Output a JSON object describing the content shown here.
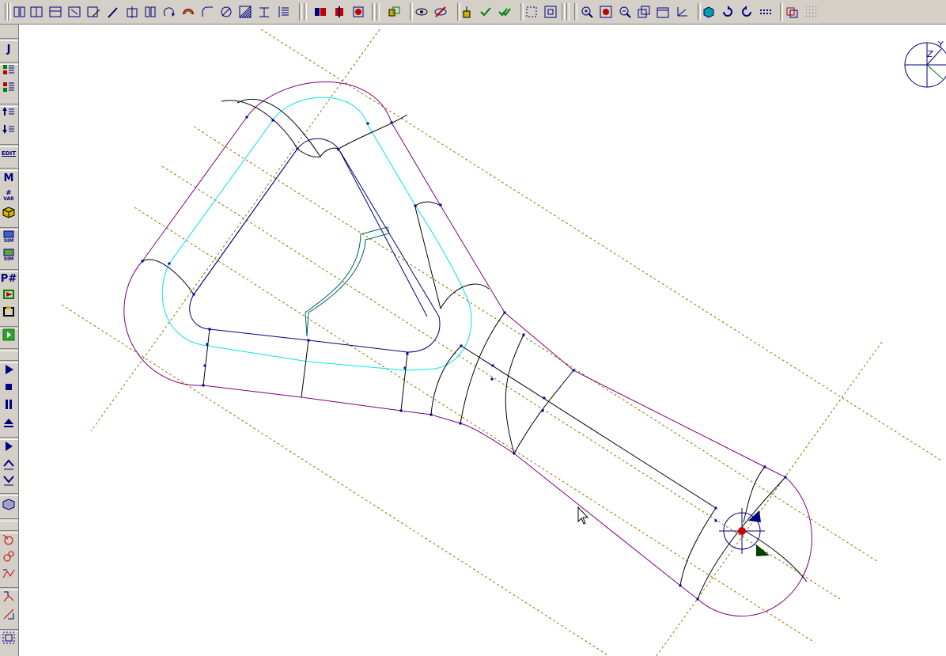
{
  "app": {
    "type": "CAM/CAD drawing view",
    "background_color": "#ffffff",
    "toolbar_color": "#d4d0c8"
  },
  "top_toolbar": {
    "groups": [
      {
        "name": "edit-tools",
        "icons": [
          "align-left-icon",
          "align-center-icon",
          "align-top-icon",
          "distribute-icon",
          "edit-icon",
          "trim-icon",
          "split-icon",
          "mirror-icon",
          "rotate-icon",
          "offset-icon",
          "fillet-icon",
          "circle-slash-icon",
          "hatch-icon",
          "dimension-icon",
          "line-spacing-icon"
        ]
      },
      {
        "name": "view-mode",
        "icons": [
          "blue-red-view-icon",
          "red-block-icon",
          "red-circle-icon"
        ]
      },
      {
        "name": "selection",
        "icons": [
          "select-chain-icon",
          "eye-icon",
          "eye-off-icon",
          "pick-icon",
          "check-icon",
          "double-check-icon",
          "frame-icon",
          "frame-all-icon"
        ]
      },
      {
        "name": "zoom",
        "icons": [
          "zoom-in-icon",
          "zoom-fit-icon",
          "zoom-out-icon",
          "view-copy-icon",
          "window-icon",
          "axis-icon",
          "solid-cube-icon",
          "refresh-icon",
          "rotate-view-icon",
          "grid-dots-icon"
        ]
      },
      {
        "name": "layers",
        "icons": [
          "layers-icon",
          "grid-icon"
        ]
      }
    ]
  },
  "left_toolbar": {
    "items": [
      {
        "name": "j-icon",
        "glyph": "J"
      },
      {
        "name": "list-green-icon"
      },
      {
        "name": "list-red-icon"
      },
      {
        "name": "move-up-icon"
      },
      {
        "name": "move-down-icon"
      },
      {
        "name": "edit-icon",
        "glyph": "EDIT"
      },
      {
        "name": "m-icon",
        "glyph": "M"
      },
      {
        "name": "var-icon",
        "glyph": "#",
        "sub": "VAR"
      },
      {
        "name": "cube-yellow-icon"
      },
      {
        "name": "sim-icon",
        "sub": "SIM"
      },
      {
        "name": "sim2-icon",
        "sub": "SIM"
      },
      {
        "name": "p-number-icon",
        "glyph": "P#"
      },
      {
        "name": "post-icon"
      },
      {
        "name": "post-alt-icon"
      },
      {
        "name": "exit-green-icon"
      },
      {
        "name": "play-icon"
      },
      {
        "name": "stop-icon"
      },
      {
        "name": "pause-icon"
      },
      {
        "name": "eject-icon"
      },
      {
        "name": "step-play-icon"
      },
      {
        "name": "step-up-icon"
      },
      {
        "name": "step-down-icon"
      },
      {
        "name": "stock-cube-icon"
      },
      {
        "name": "tool-red-1-icon"
      },
      {
        "name": "tool-red-2-icon"
      },
      {
        "name": "tool-red-3-icon"
      },
      {
        "name": "tool-path-1-icon"
      },
      {
        "name": "tool-path-2-icon"
      },
      {
        "name": "frame-bottom-icon"
      }
    ]
  },
  "view_gizmo": {
    "labels": [
      "Y",
      "Z"
    ]
  },
  "colors": {
    "outer_contour": "#800080",
    "inner_contour": "#00e5e5",
    "pocket_contour": "#000080",
    "wire_lines": "#000000",
    "construction_lines": "#8b7a00",
    "island": "#006060",
    "nodes": "#0000a0",
    "origin_red": "#d00000",
    "axis_blue": "#000080",
    "axis_green": "#004000"
  }
}
